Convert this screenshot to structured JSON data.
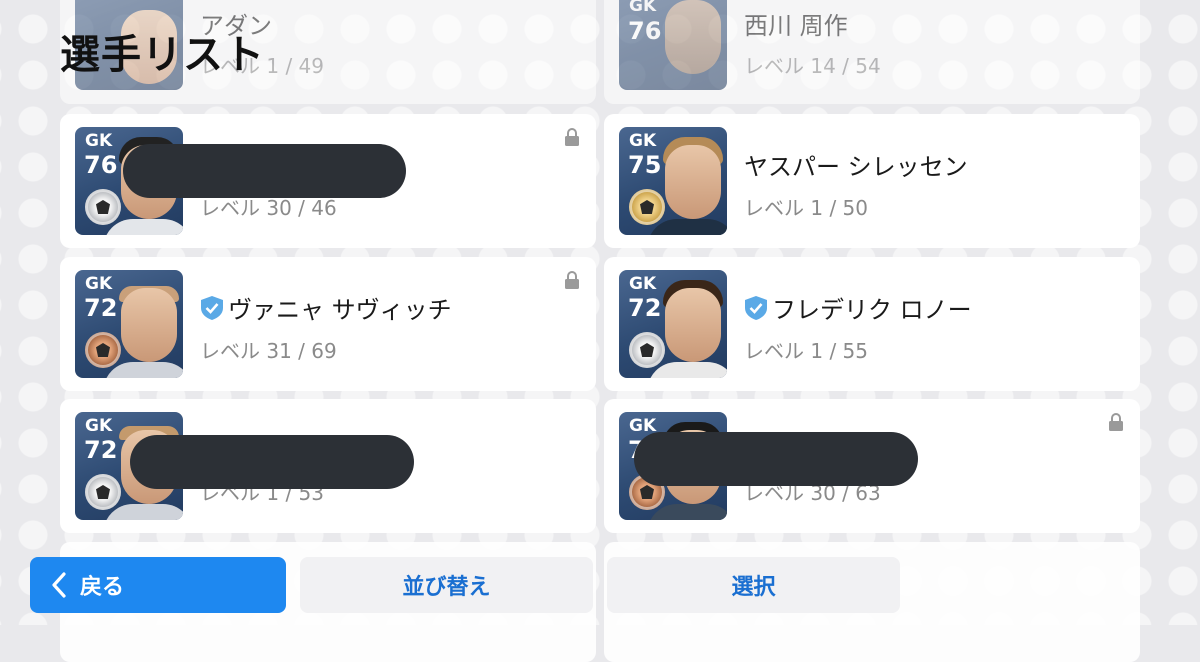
{
  "page_title": "選手リスト",
  "top_partial": [
    {
      "name": "アダン",
      "level": "レベル 1 / 49"
    },
    {
      "name": "西川 周作",
      "position": "GK",
      "rating": "76",
      "level": "レベル 14 / 54"
    }
  ],
  "players": [
    {
      "position": "GK",
      "rating": "76",
      "medal": "silver",
      "name": "",
      "level": "レベル 30 / 46",
      "locked": true,
      "verified": false,
      "redacted": true
    },
    {
      "position": "GK",
      "rating": "75",
      "medal": "gold",
      "name": "ヤスパー シレッセン",
      "level": "レベル 1 / 50",
      "locked": false,
      "verified": false,
      "redacted": false
    },
    {
      "position": "GK",
      "rating": "72",
      "medal": "bronze",
      "name": "ヴァニャ サヴィッチ",
      "level": "レベル 31 / 69",
      "locked": true,
      "verified": true,
      "redacted": false
    },
    {
      "position": "GK",
      "rating": "72",
      "medal": "silver",
      "name": "フレデリク ロノー",
      "level": "レベル 1 / 55",
      "locked": false,
      "verified": true,
      "redacted": false
    },
    {
      "position": "GK",
      "rating": "72",
      "medal": "silver",
      "name": "",
      "level": "レベル 1 / 53",
      "locked": false,
      "verified": false,
      "redacted": true
    },
    {
      "position": "GK",
      "rating": "7",
      "medal": "bronze",
      "name": "",
      "level": "レベル 30 / 63",
      "locked": true,
      "verified": false,
      "redacted": true
    }
  ],
  "buttons": {
    "back": "戻る",
    "sort": "並び替え",
    "select": "選択"
  },
  "colors": {
    "accent": "#1e88f0",
    "verified": "#5aa9e6",
    "redaction": "#2c3036"
  }
}
